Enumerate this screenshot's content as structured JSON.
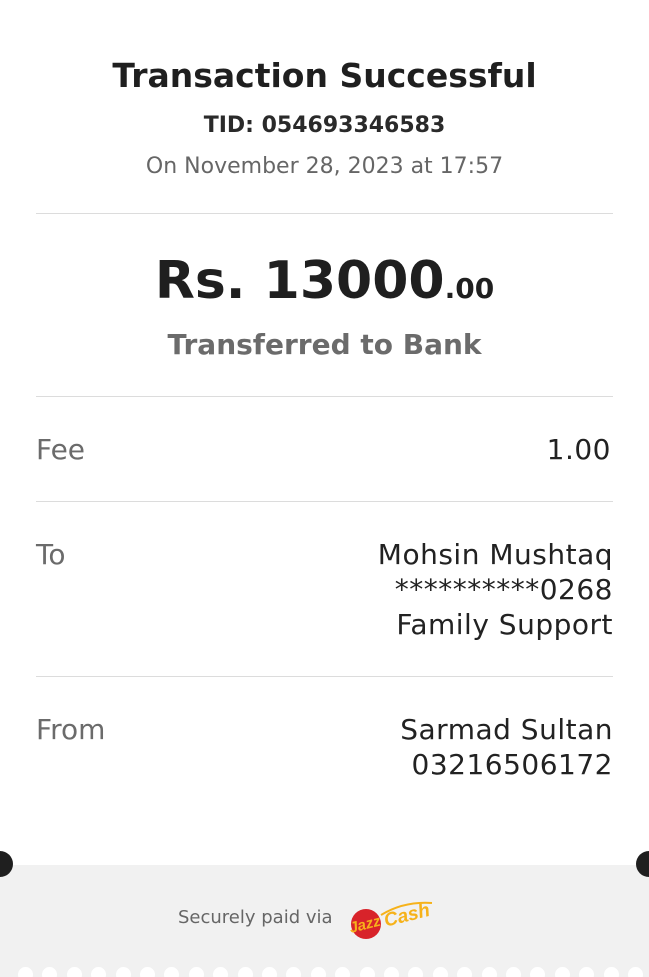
{
  "receipt": {
    "title": "Transaction Successful",
    "tid": "TID: 054693346583",
    "date": "On November 28, 2023 at 17:57",
    "amount_main": "Rs. 13000",
    "amount_decimal": ".00",
    "subtitle": "Transferred to Bank",
    "fee": {
      "label": "Fee",
      "value": "1.00"
    },
    "to": {
      "label": "To",
      "name": "Mohsin Mushtaq",
      "account": "**********0268",
      "purpose": "Family Support"
    },
    "from": {
      "label": "From",
      "name": "Sarmad Sultan",
      "number": "03216506172"
    }
  },
  "footer": {
    "secure_text": "Securely paid via",
    "logo_text_jazz": "Jazz",
    "logo_text_cash": "Cash",
    "logo_colors": {
      "red": "#d8232a",
      "yellow": "#f6b21a"
    },
    "background": "#f1f1f1"
  }
}
